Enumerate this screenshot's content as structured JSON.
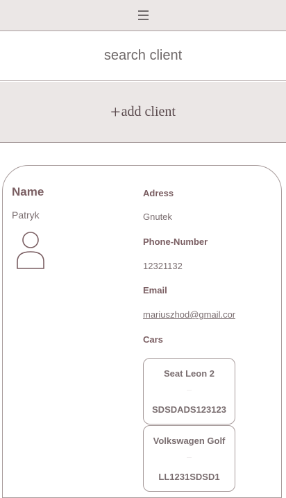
{
  "header": {
    "menu_icon": "hamburger-menu-icon"
  },
  "search": {
    "placeholder": "search client",
    "value": ""
  },
  "add_client": {
    "plus": "+",
    "label": "add client"
  },
  "client": {
    "name_label": "Name",
    "name": "Patryk",
    "avatar_icon": "user-icon",
    "address_label": "Adress",
    "address": "Gnutek",
    "phone_label": "Phone-Number",
    "phone": "12321132",
    "email_label": "Email",
    "email": "mariuszhod@gmail.com",
    "cars_label": "Cars",
    "cars": [
      {
        "model": "Seat Leon 2",
        "tiny": "-------",
        "plate": "SDSDADS123123"
      },
      {
        "model": "Volkswagen Golf",
        "tiny": "-------",
        "plate": "LL1231SDSD1"
      }
    ]
  },
  "colors": {
    "header_bg": "#ebe7e6",
    "border": "#a89c9c",
    "text": "#7a5e62"
  }
}
